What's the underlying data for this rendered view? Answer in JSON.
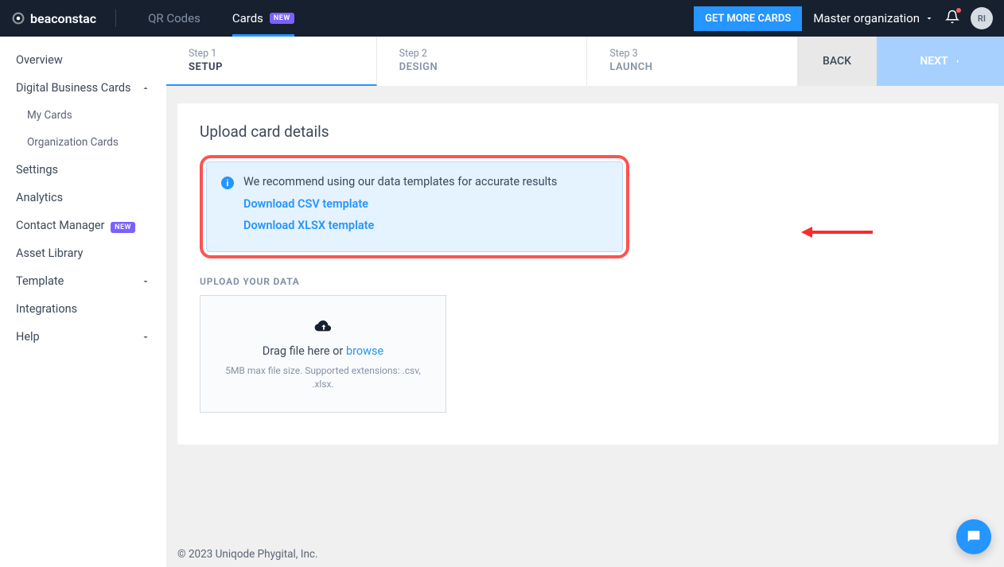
{
  "header": {
    "logo_text": "beaconstac",
    "nav": {
      "qr": "QR Codes",
      "cards": "Cards",
      "new_badge": "NEW"
    },
    "get_more": "GET MORE CARDS",
    "org": "Master organization",
    "avatar_initials": "RI"
  },
  "sidebar": {
    "overview": "Overview",
    "dbc": "Digital Business Cards",
    "my_cards": "My Cards",
    "org_cards": "Organization Cards",
    "settings": "Settings",
    "analytics": "Analytics",
    "contact_mgr": "Contact Manager",
    "contact_mgr_badge": "NEW",
    "asset_lib": "Asset Library",
    "template": "Template",
    "integrations": "Integrations",
    "help": "Help"
  },
  "stepper": {
    "s1n": "Step 1",
    "s1": "SETUP",
    "s2n": "Step 2",
    "s2": "DESIGN",
    "s3n": "Step 3",
    "s3": "LAUNCH",
    "back": "BACK",
    "next": "NEXT"
  },
  "content": {
    "title": "Upload card details",
    "info_text": "We recommend using our data templates for accurate results",
    "csv_link": "Download CSV template",
    "xlsx_link": "Download XLSX template",
    "upload_label": "UPLOAD YOUR DATA",
    "dz_text_pre": "Drag file here or ",
    "dz_browse": "browse",
    "dz_hint": "5MB max file size. Supported extensions: .csv, .xlsx."
  },
  "footer": "© 2023 Uniqode Phygital, Inc."
}
